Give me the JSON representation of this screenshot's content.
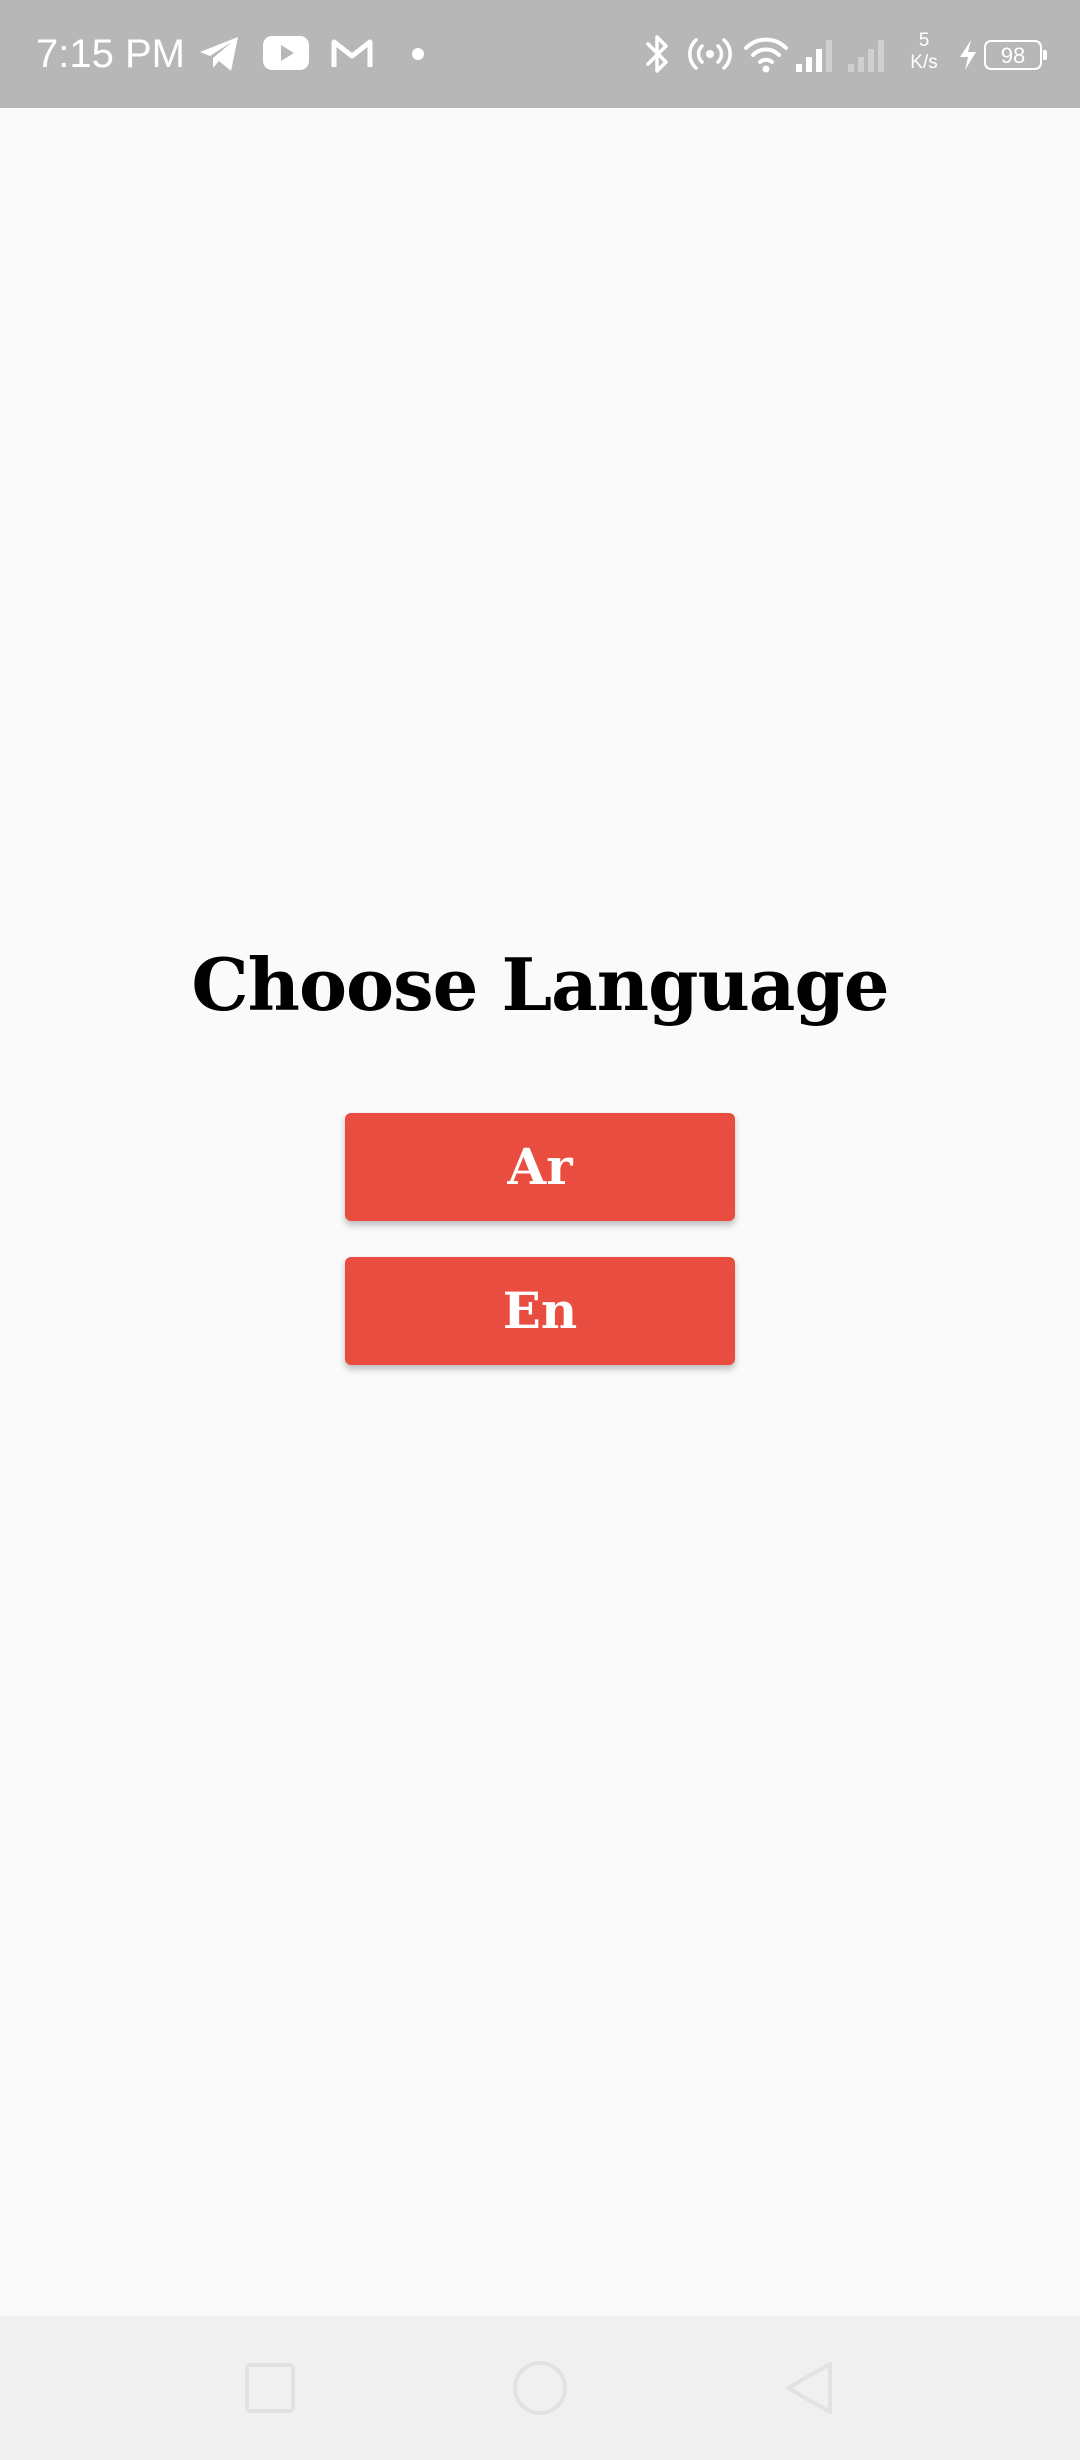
{
  "status_bar": {
    "time": "7:15 PM",
    "notification_icons": [
      "telegram-icon",
      "youtube-icon",
      "gmail-icon",
      "dot-icon"
    ],
    "system_icons": [
      "bluetooth-icon",
      "hotspot-icon",
      "wifi-icon",
      "signal-icon",
      "signal-2-icon",
      "charging-icon"
    ],
    "net_speed_value": "5",
    "net_speed_unit": "K/s",
    "battery_level": "98"
  },
  "main": {
    "title": "Choose Language",
    "buttons": [
      {
        "label": "Ar"
      },
      {
        "label": "En"
      }
    ]
  },
  "nav_bar": {
    "buttons": [
      "recent-apps-icon",
      "home-icon",
      "back-icon"
    ]
  },
  "colors": {
    "status_bar_bg": "#b7b7b7",
    "page_bg": "#fafafa",
    "button_bg": "#e84d3f",
    "button_text": "#ffffff",
    "title_text": "#000000",
    "nav_bar_bg": "#f0f0f0"
  }
}
